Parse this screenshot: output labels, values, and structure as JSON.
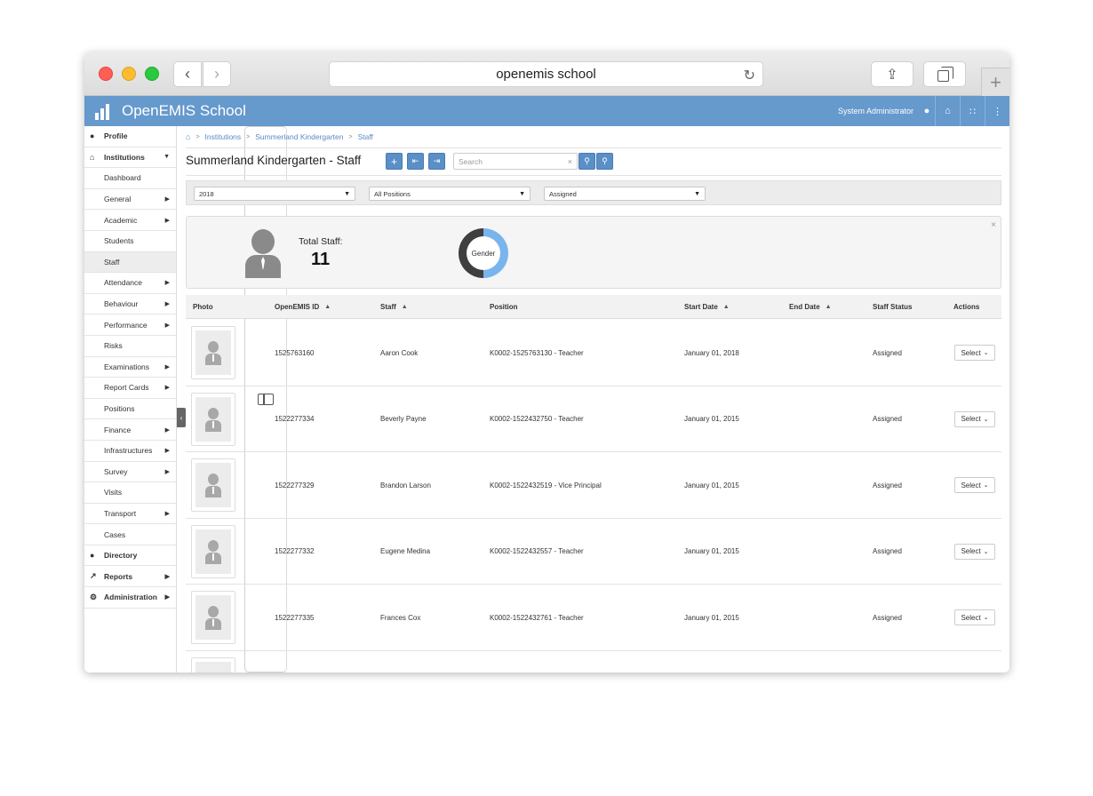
{
  "browser": {
    "url_title": "openemis school"
  },
  "app": {
    "title": "OpenEMIS School",
    "user": "System Administrator",
    "brand_color": "#6699cc"
  },
  "sidebar": {
    "items": [
      {
        "label": "Profile",
        "type": "top",
        "icon": "user-icon"
      },
      {
        "label": "Institutions",
        "type": "top",
        "icon": "bank-icon",
        "expanded": true
      },
      {
        "label": "Dashboard",
        "type": "sub"
      },
      {
        "label": "General",
        "type": "sub",
        "caret": true
      },
      {
        "label": "Academic",
        "type": "sub",
        "caret": true
      },
      {
        "label": "Students",
        "type": "sub"
      },
      {
        "label": "Staff",
        "type": "sub",
        "active": true
      },
      {
        "label": "Attendance",
        "type": "sub",
        "caret": true
      },
      {
        "label": "Behaviour",
        "type": "sub",
        "caret": true
      },
      {
        "label": "Performance",
        "type": "sub",
        "caret": true
      },
      {
        "label": "Risks",
        "type": "sub"
      },
      {
        "label": "Examinations",
        "type": "sub",
        "caret": true
      },
      {
        "label": "Report Cards",
        "type": "sub",
        "caret": true
      },
      {
        "label": "Positions",
        "type": "sub"
      },
      {
        "label": "Finance",
        "type": "sub",
        "caret": true
      },
      {
        "label": "Infrastructures",
        "type": "sub",
        "caret": true
      },
      {
        "label": "Survey",
        "type": "sub",
        "caret": true
      },
      {
        "label": "Visits",
        "type": "sub"
      },
      {
        "label": "Transport",
        "type": "sub",
        "caret": true
      },
      {
        "label": "Cases",
        "type": "sub"
      },
      {
        "label": "Directory",
        "type": "top",
        "icon": "users-icon"
      },
      {
        "label": "Reports",
        "type": "top",
        "icon": "chart-icon",
        "caret": true
      },
      {
        "label": "Administration",
        "type": "top",
        "icon": "gears-icon",
        "caret": true
      }
    ]
  },
  "breadcrumb": [
    "Institutions",
    "Summerland Kindergarten",
    "Staff"
  ],
  "page": {
    "title": "Summerland Kindergarten - Staff"
  },
  "search": {
    "placeholder": "Search",
    "value": ""
  },
  "filters": {
    "year": "2018",
    "positions": "All Positions",
    "status": "Assigned"
  },
  "stats": {
    "total_label": "Total Staff:",
    "total_value": "11",
    "chart_label": "Gender"
  },
  "table": {
    "columns": [
      "Photo",
      "OpenEMIS ID",
      "Staff",
      "Position",
      "Start Date",
      "End Date",
      "Staff Status",
      "Actions"
    ],
    "rows": [
      {
        "id": "1525763160",
        "staff": "Aaron Cook",
        "position": "K0002-1525763130 - Teacher",
        "start": "January 01, 2018",
        "end": "",
        "status": "Assigned",
        "action": "Select"
      },
      {
        "id": "1522277334",
        "staff": "Beverly Payne",
        "position": "K0002-1522432750 - Teacher",
        "start": "January 01, 2015",
        "end": "",
        "status": "Assigned",
        "action": "Select"
      },
      {
        "id": "1522277329",
        "staff": "Brandon Larson",
        "position": "K0002-1522432519 - Vice Principal",
        "start": "January 01, 2015",
        "end": "",
        "status": "Assigned",
        "action": "Select"
      },
      {
        "id": "1522277332",
        "staff": "Eugene Medina",
        "position": "K0002-1522432557 - Teacher",
        "start": "January 01, 2015",
        "end": "",
        "status": "Assigned",
        "action": "Select"
      },
      {
        "id": "1522277335",
        "staff": "Frances Cox",
        "position": "K0002-1522432761 - Teacher",
        "start": "January 01, 2015",
        "end": "",
        "status": "Assigned",
        "action": "Select"
      }
    ]
  }
}
